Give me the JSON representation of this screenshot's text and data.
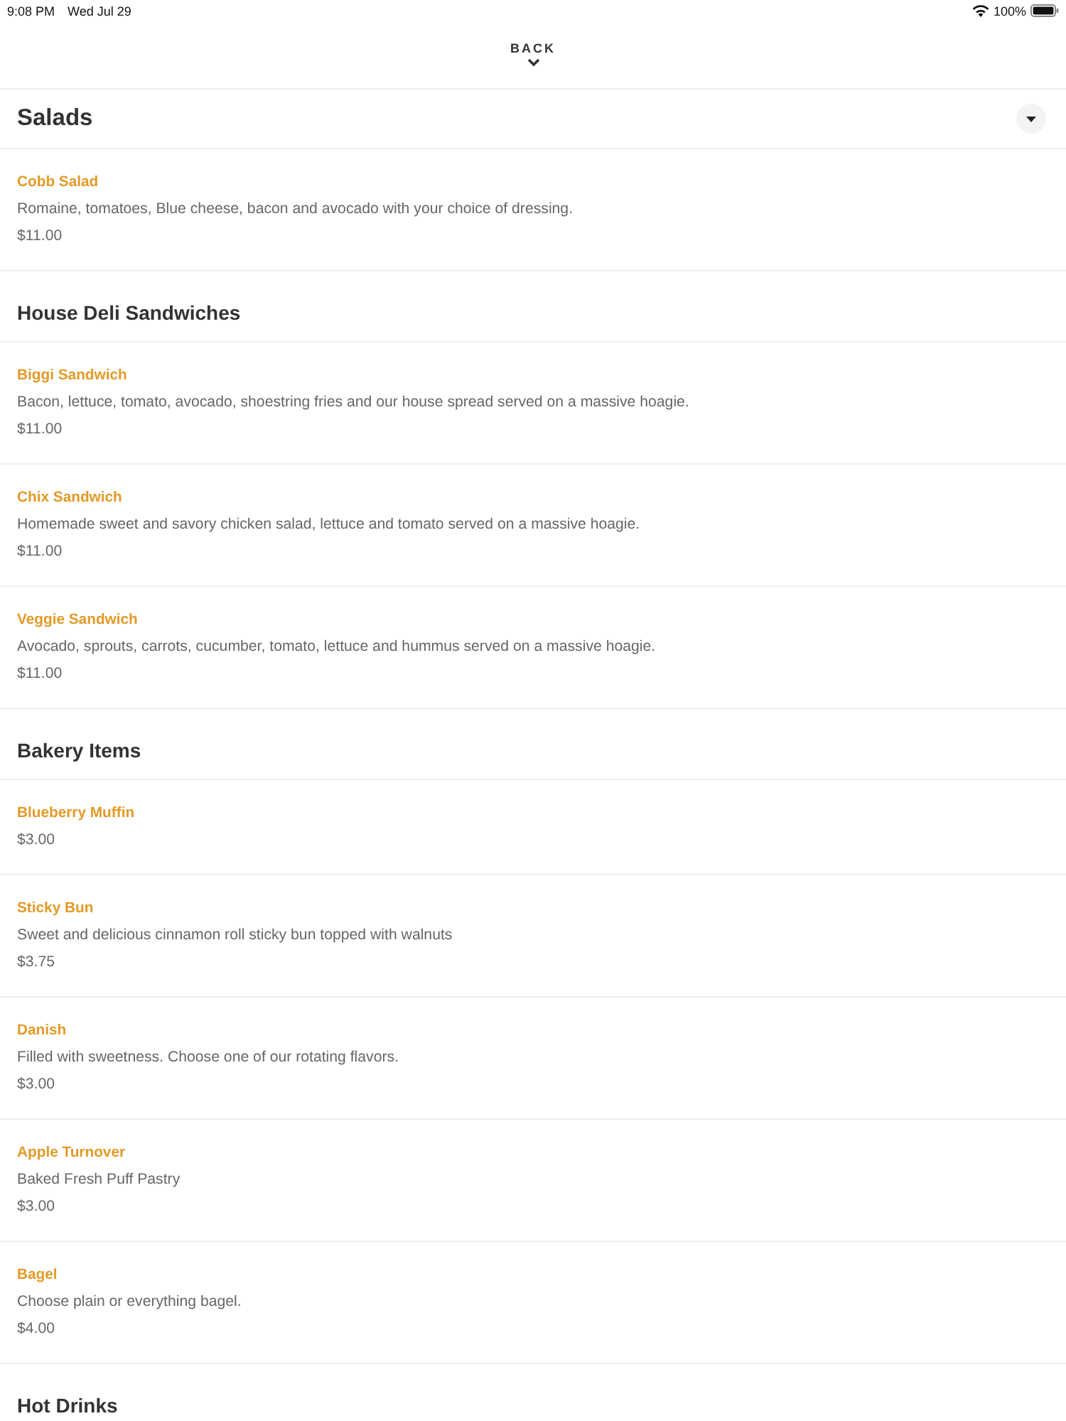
{
  "status_bar": {
    "time": "9:08 PM",
    "date": "Wed Jul 29",
    "battery": "100%"
  },
  "header": {
    "back_label": "BACK"
  },
  "sections": [
    {
      "kind": "sticky",
      "title": "Salads",
      "items": [
        {
          "name": "Cobb Salad",
          "description": "Romaine, tomatoes, Blue cheese, bacon and avocado with your choice of dressing.",
          "price": "$11.00"
        }
      ]
    },
    {
      "kind": "plain",
      "title": "House Deli Sandwiches",
      "items": [
        {
          "name": "Biggi Sandwich",
          "description": "Bacon, lettuce, tomato, avocado, shoestring fries and our house spread served on a massive hoagie.",
          "price": "$11.00"
        },
        {
          "name": "Chix Sandwich",
          "description": "Homemade sweet and savory chicken salad, lettuce and tomato served on a massive hoagie.",
          "price": "$11.00"
        },
        {
          "name": "Veggie Sandwich",
          "description": "Avocado, sprouts, carrots, cucumber, tomato, lettuce and hummus served on a massive hoagie.",
          "price": "$11.00"
        }
      ]
    },
    {
      "kind": "plain",
      "title": "Bakery Items",
      "items": [
        {
          "name": "Blueberry Muffin",
          "price": "$3.00"
        },
        {
          "name": "Sticky Bun",
          "description": "Sweet and delicious cinnamon roll sticky bun topped with walnuts",
          "price": "$3.75"
        },
        {
          "name": "Danish",
          "description": "Filled with sweetness. Choose one of our rotating flavors.",
          "price": "$3.00"
        },
        {
          "name": "Apple Turnover",
          "description": "Baked Fresh Puff Pastry",
          "price": "$3.00"
        },
        {
          "name": "Bagel",
          "description": "Choose plain or everything bagel.",
          "price": "$4.00"
        }
      ]
    },
    {
      "kind": "plain",
      "title": "Hot Drinks"
    }
  ]
}
